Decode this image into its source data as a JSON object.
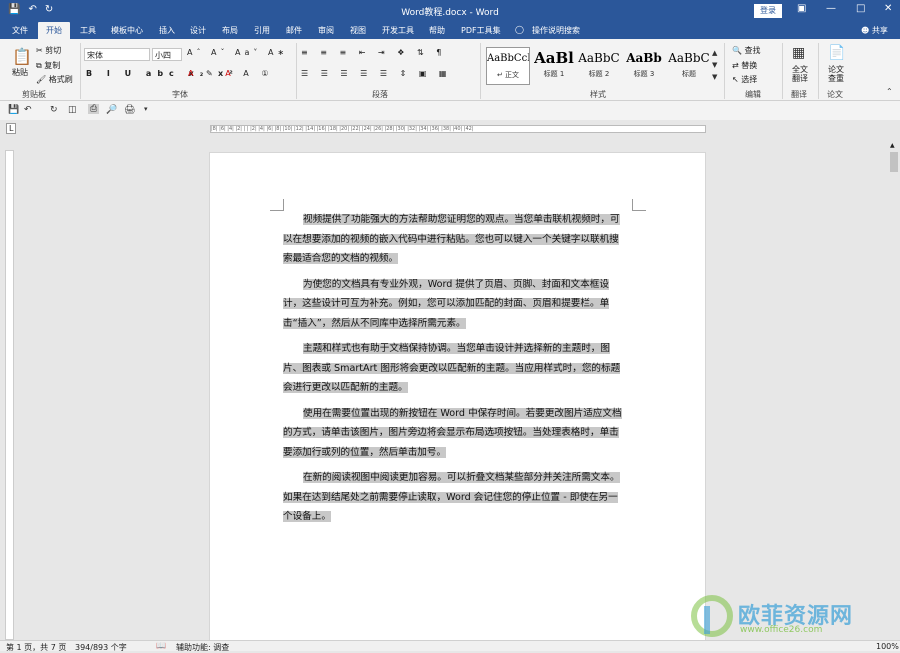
{
  "app": {
    "title": "Word教程.docx - Word",
    "login": "登录",
    "share": "共享"
  },
  "tabs": [
    {
      "label": "文件"
    },
    {
      "label": "开始"
    },
    {
      "label": "工具"
    },
    {
      "label": "模板中心"
    },
    {
      "label": "插入"
    },
    {
      "label": "设计"
    },
    {
      "label": "布局"
    },
    {
      "label": "引用"
    },
    {
      "label": "邮件"
    },
    {
      "label": "审阅"
    },
    {
      "label": "视图"
    },
    {
      "label": "开发工具"
    },
    {
      "label": "帮助"
    },
    {
      "label": "PDF工具集"
    },
    {
      "label": "操作说明搜索"
    }
  ],
  "ribbon": {
    "clipboard": {
      "paste": "粘贴",
      "cut": "剪切",
      "copy": "复制",
      "format_painter": "格式刷",
      "label": "剪贴板"
    },
    "font": {
      "name": "宋体",
      "size": "小四",
      "label": "字体"
    },
    "paragraph": {
      "label": "段落"
    },
    "styles": {
      "label": "样式",
      "items": [
        {
          "preview": "AaBbCcI",
          "name": "↵ 正文"
        },
        {
          "preview": "AaBl",
          "name": "标题 1"
        },
        {
          "preview": "AaBbC",
          "name": "标题 2"
        },
        {
          "preview": "AaBb",
          "name": "标题 3"
        },
        {
          "preview": "AaBbC",
          "name": "标题"
        }
      ]
    },
    "edit": {
      "find": "查找",
      "replace": "替换",
      "select": "选择",
      "label": "编辑"
    },
    "translate": {
      "btn": "全文翻译",
      "label": "翻译"
    },
    "paper": {
      "btn": "论文查重",
      "label": "论文"
    }
  },
  "document": {
    "paragraphs": [
      "视频提供了功能强大的方法帮助您证明您的观点。当您单击联机视频时，可以在想要添加的视频的嵌入代码中进行粘贴。您也可以键入一个关键字以联机搜索最适合您的文档的视频。",
      "为使您的文档具有专业外观，Word 提供了页眉、页脚、封面和文本框设计，这些设计可互为补充。例如，您可以添加匹配的封面、页眉和提要栏。单击“插入”，然后从不同库中选择所需元素。",
      "主题和样式也有助于文档保持协调。当您单击设计并选择新的主题时，图片、图表或 SmartArt 图形将会更改以匹配新的主题。当应用样式时，您的标题会进行更改以匹配新的主题。",
      "使用在需要位置出现的新按钮在 Word 中保存时间。若要更改图片适应文档的方式，请单击该图片，图片旁边将会显示布局选项按钮。当处理表格时，单击要添加行或列的位置，然后单击加号。",
      "在新的阅读视图中阅读更加容易。可以折叠文档某些部分并关注所需文本。如果在达到结尾处之前需要停止读取，Word 会记住您的停止位置 - 即使在另一个设备上。"
    ]
  },
  "ruler": {
    "text": "|8| |6| |4| |2| | | |2| |4| |6| |8| |10| |12| |14| |16| |18| |20| |22| |24| |26| |28| |30| |32| |34| |36| |38| |40| |42|"
  },
  "status": {
    "page": "第 1 页，共 7 页",
    "words": "394/893 个字",
    "accessibility": "辅助功能: 调查",
    "zoom": "100%"
  },
  "watermark": {
    "cn": "欧菲资源网",
    "url": "www.office26.com"
  }
}
